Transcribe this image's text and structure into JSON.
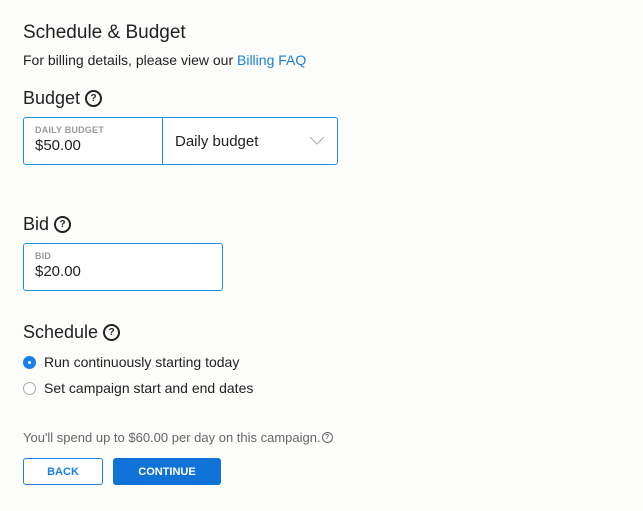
{
  "title": "Schedule & Budget",
  "billing": {
    "text": "For billing details, please view our ",
    "link": "Billing FAQ"
  },
  "budget": {
    "heading": "Budget",
    "field_label": "DAILY BUDGET",
    "value": "$50.00",
    "type_selected": "Daily budget"
  },
  "bid": {
    "heading": "Bid",
    "field_label": "BID",
    "value": "$20.00"
  },
  "schedule": {
    "heading": "Schedule",
    "options": [
      {
        "label": "Run continuously starting today",
        "selected": true
      },
      {
        "label": "Set campaign start and end dates",
        "selected": false
      }
    ]
  },
  "summary": "You'll spend up to $60.00 per day on this campaign.",
  "buttons": {
    "back": "BACK",
    "continue": "CONTINUE"
  },
  "colors": {
    "accent": "#1a7fe8",
    "link": "#1a7fd4"
  },
  "icons": {
    "help": "question-circle-icon",
    "dropdown": "chevron-down-icon"
  }
}
